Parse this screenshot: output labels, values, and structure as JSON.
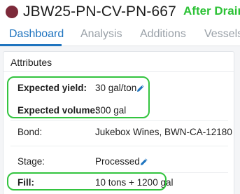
{
  "header": {
    "lot_code": "JBW25-PN-CV-PN-667",
    "annotation": "After Drain",
    "lot_color": "#7d2a3a",
    "annotation_color": "#2cc236"
  },
  "tabs": [
    {
      "label": "Dashboard",
      "active": true
    },
    {
      "label": "Analysis",
      "active": false
    },
    {
      "label": "Additions",
      "active": false
    },
    {
      "label": "Vessels",
      "active": false
    }
  ],
  "attributes": {
    "title": "Attributes",
    "rows": [
      {
        "label": "Expected yield:",
        "value": "30 gal/ton",
        "editable": true,
        "bold": true
      },
      {
        "label": "Expected volume:",
        "value": "300 gal",
        "editable": false,
        "bold": true
      },
      {
        "label": "Bond:",
        "value": "Jukebox Wines, BWN-CA-12180",
        "editable": false,
        "bold": false
      },
      {
        "label": "Stage:",
        "value": "Processed",
        "editable": true,
        "bold": false
      },
      {
        "label": "Fill:",
        "value": "10 tons + 1200 gal",
        "editable": false,
        "bold": true
      }
    ]
  },
  "accent_color": "#1f74bf",
  "highlight_color": "#33c43f"
}
